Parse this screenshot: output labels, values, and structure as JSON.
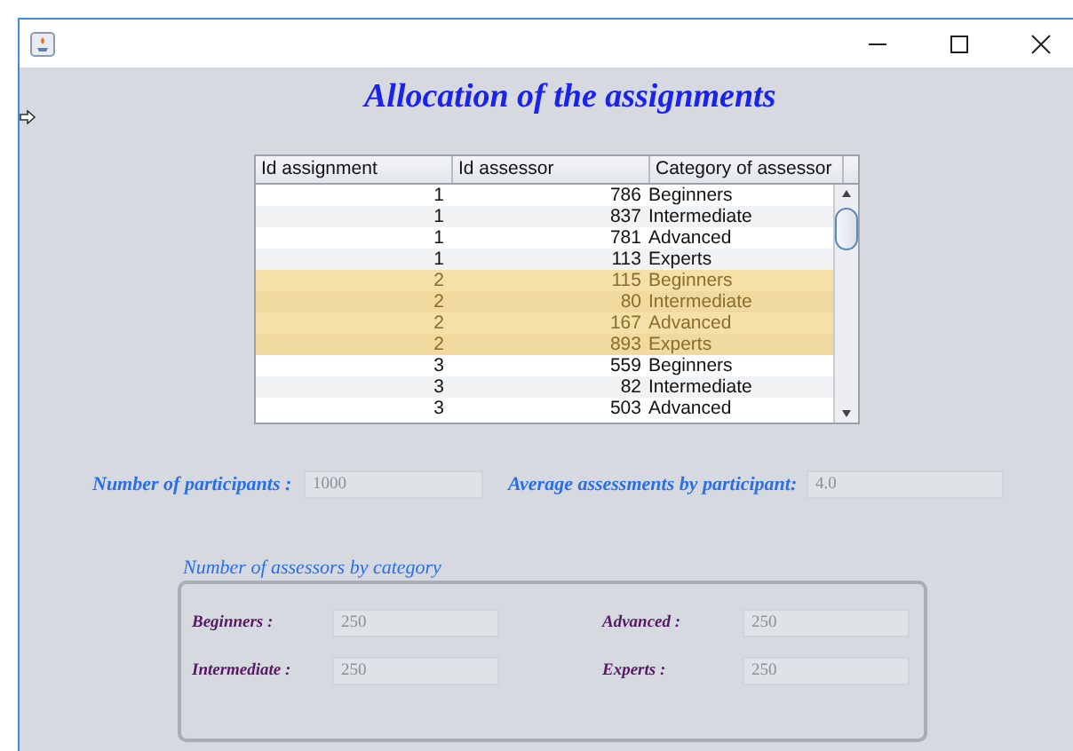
{
  "window": {
    "title": "Allocation of the assignments"
  },
  "table": {
    "columns": [
      "Id assignment",
      "Id assessor",
      "Category of assessor"
    ],
    "rows": [
      {
        "cells": [
          "1",
          "786",
          "Beginners"
        ],
        "selected": false
      },
      {
        "cells": [
          "1",
          "837",
          "Intermediate"
        ],
        "selected": false
      },
      {
        "cells": [
          "1",
          "781",
          "Advanced"
        ],
        "selected": false
      },
      {
        "cells": [
          "1",
          "113",
          "Experts"
        ],
        "selected": false
      },
      {
        "cells": [
          "2",
          "115",
          "Beginners"
        ],
        "selected": true
      },
      {
        "cells": [
          "2",
          "80",
          "Intermediate"
        ],
        "selected": true
      },
      {
        "cells": [
          "2",
          "167",
          "Advanced"
        ],
        "selected": true
      },
      {
        "cells": [
          "2",
          "893",
          "Experts"
        ],
        "selected": true
      },
      {
        "cells": [
          "3",
          "559",
          "Beginners"
        ],
        "selected": false
      },
      {
        "cells": [
          "3",
          "82",
          "Intermediate"
        ],
        "selected": false
      },
      {
        "cells": [
          "3",
          "503",
          "Advanced"
        ],
        "selected": false
      }
    ]
  },
  "summary": [
    {
      "label": "Number of participants :",
      "value": "1000",
      "disabled": true
    },
    {
      "label": "Average assessments by participant:",
      "value": "4.0",
      "disabled": true
    }
  ],
  "group": {
    "title": "Number of assessors by category",
    "fields": [
      {
        "label": "Beginners :",
        "value": "250",
        "disabled": true
      },
      {
        "label": "Advanced :",
        "value": "250",
        "disabled": true
      },
      {
        "label": "Intermediate :",
        "value": "250",
        "disabled": true
      },
      {
        "label": "Experts :",
        "value": "250",
        "disabled": true
      }
    ]
  }
}
